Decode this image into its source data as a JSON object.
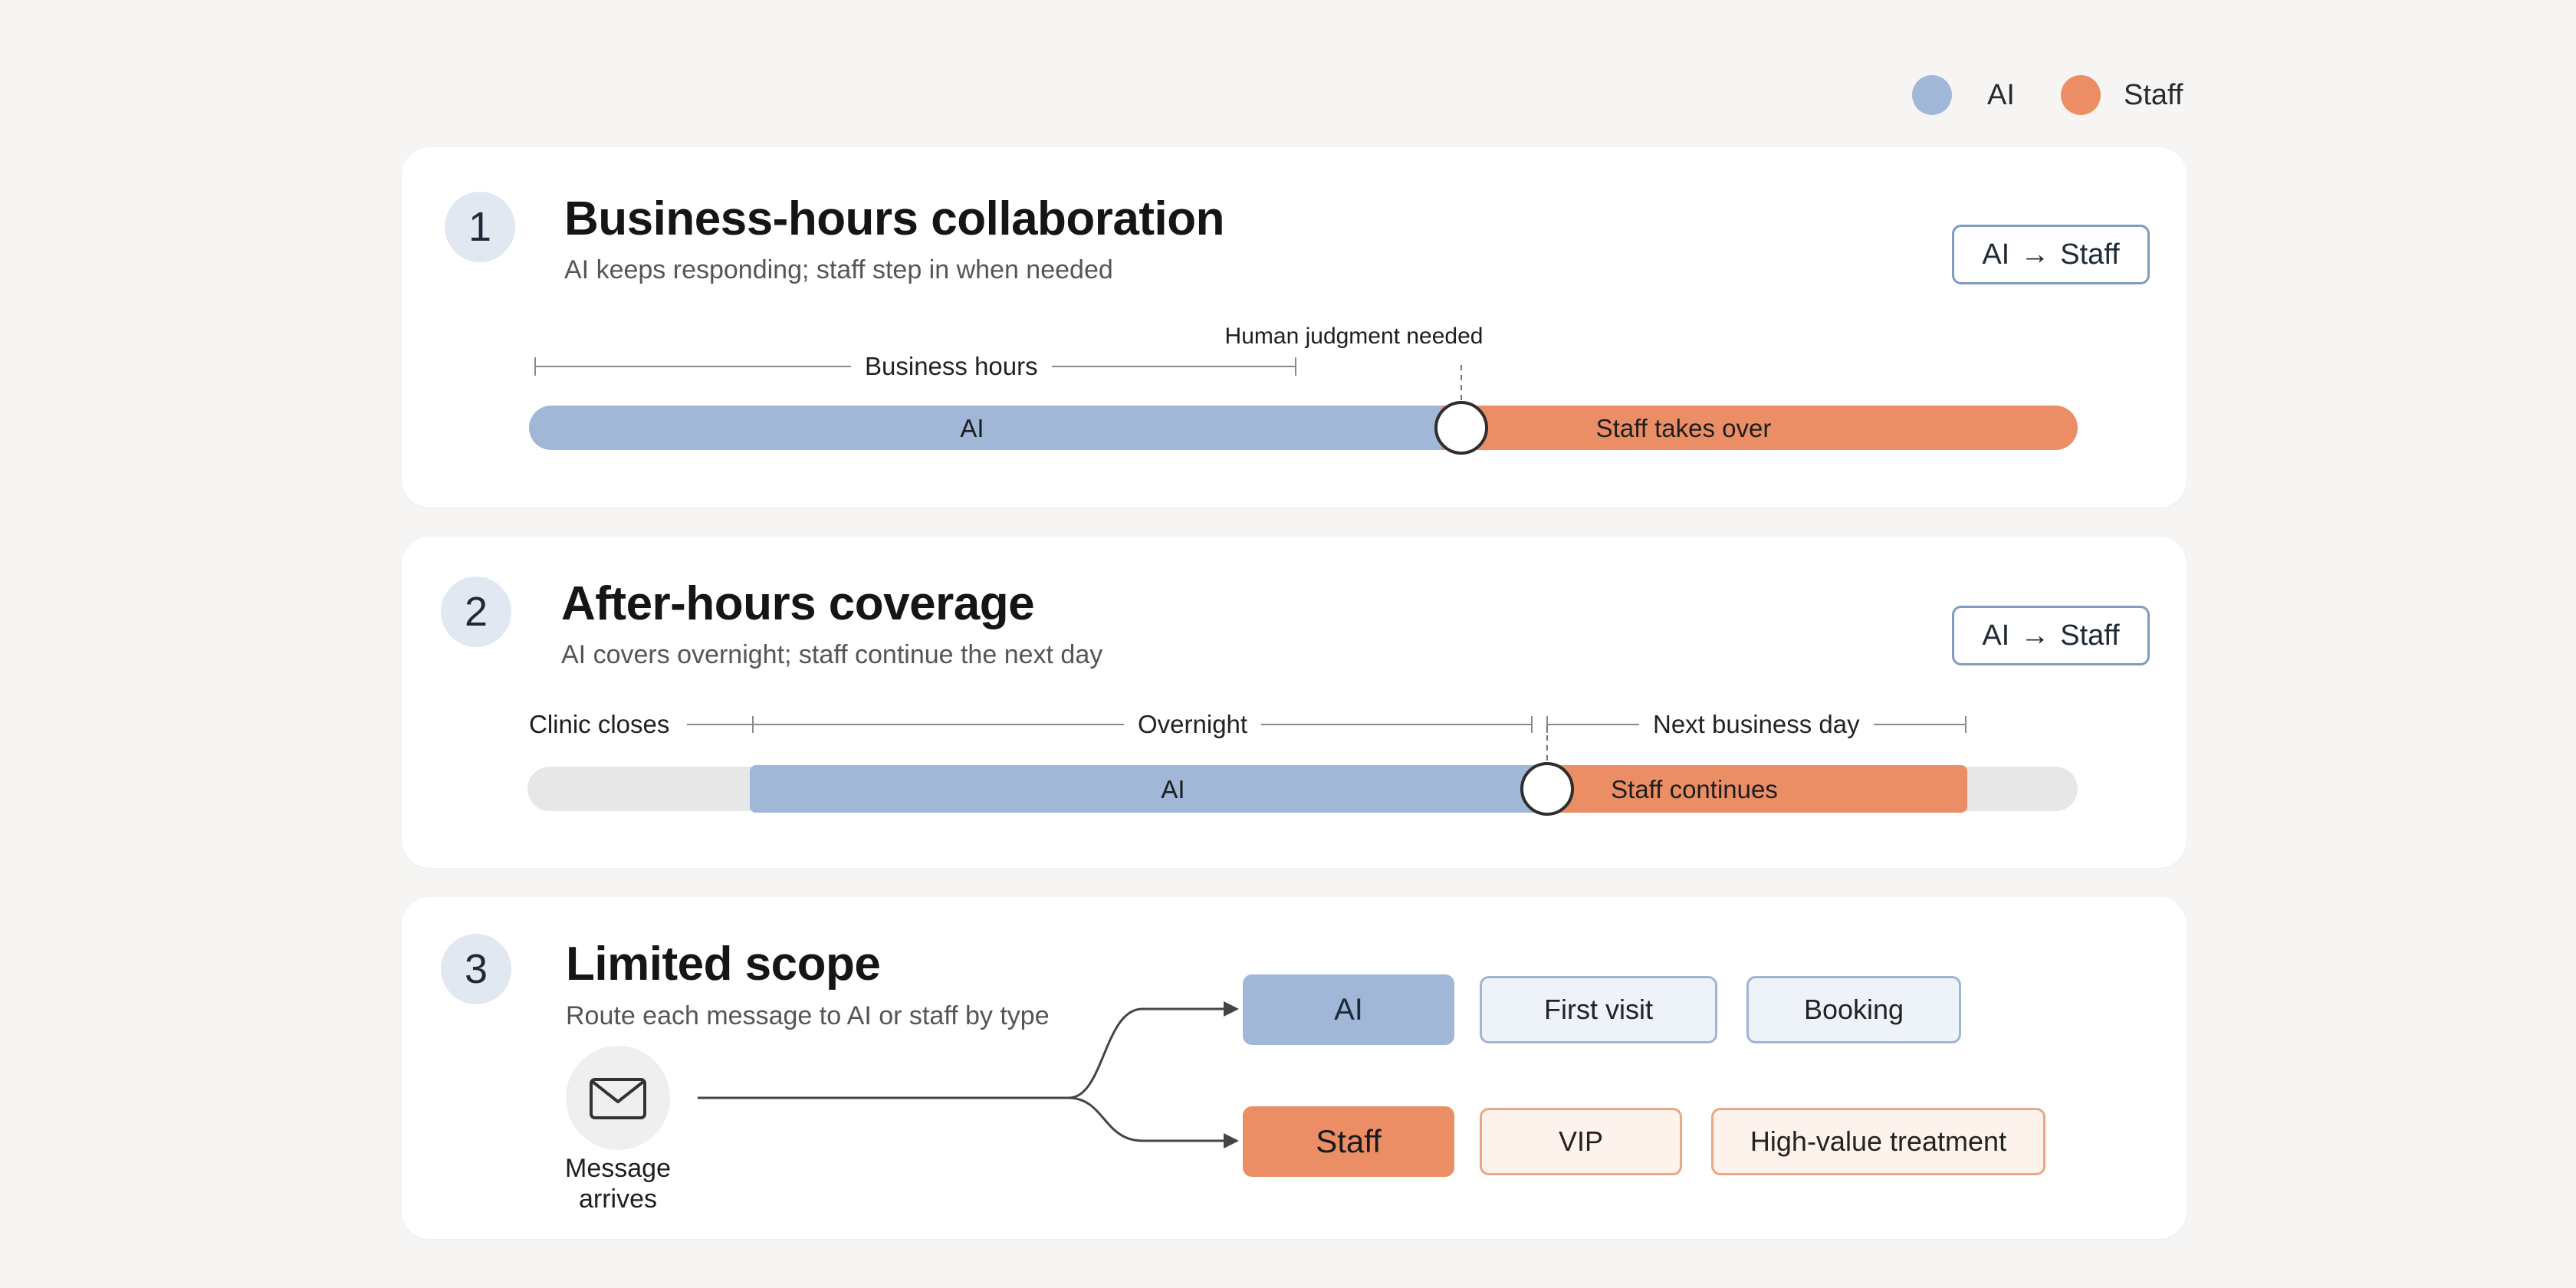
{
  "legend": {
    "ai_label": "AI",
    "staff_label": "Staff",
    "ai_color": "#a1b7d8",
    "staff_color": "#eb8e66"
  },
  "cards": [
    {
      "number": "1",
      "title": "Business-hours collaboration",
      "subtitle": "AI keeps responding; staff step in when needed",
      "badge": {
        "from": "AI",
        "arrow": "→",
        "to": "Staff"
      },
      "range_label": "Business hours",
      "marker_label": "Human judgment needed",
      "ai_bar_label": "AI",
      "staff_bar_label": "Staff takes over"
    },
    {
      "number": "2",
      "title": "After-hours coverage",
      "subtitle": "AI covers overnight; staff continue the next day",
      "badge": {
        "from": "AI",
        "arrow": "→",
        "to": "Staff"
      },
      "start_label": "Clinic closes",
      "range_label": "Overnight",
      "next_label": "Next business day",
      "ai_bar_label": "AI",
      "staff_bar_label": "Staff continues"
    },
    {
      "number": "3",
      "title": "Limited scope",
      "subtitle": "Route each message to AI or staff by type",
      "source": {
        "icon": "envelope-icon",
        "label_line1": "Message",
        "label_line2": "arrives"
      },
      "ai_route": {
        "label": "AI",
        "items": [
          "First visit",
          "Booking"
        ]
      },
      "staff_route": {
        "label": "Staff",
        "items": [
          "VIP",
          "High-value treatment"
        ]
      }
    }
  ]
}
